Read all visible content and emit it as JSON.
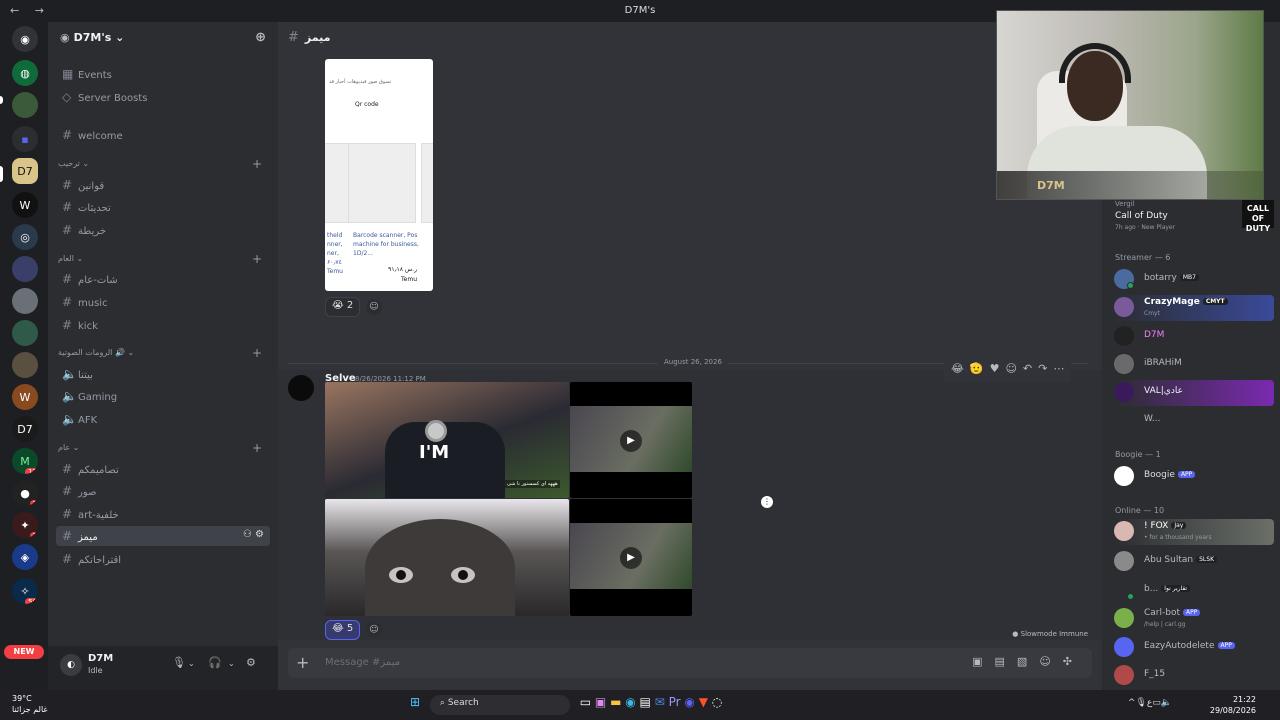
{
  "window": {
    "title": "D7M's",
    "nav": "← →"
  },
  "colors": {
    "blurple": "#5865f2",
    "online": "#23a55a",
    "danger": "#f23f43",
    "bg": "#313338"
  },
  "servers": {
    "badges": [
      "11",
      "3",
      "1",
      "56"
    ],
    "new_label": "NEW"
  },
  "server": {
    "name": "D7M's",
    "events": "Events",
    "boosts": "Server Boosts",
    "welcome": "welcome",
    "cat1": "ترحيب",
    "cat1_items": [
      "قوانين",
      "تحديثات",
      "خريطة"
    ],
    "cat2": "العام",
    "cat2_items": [
      "شات-عام",
      "music",
      "kick"
    ],
    "cat3": "الرومات الصوتية",
    "voice_items": [
      "بيتنا",
      "Gaming",
      "AFK"
    ],
    "cat4": "عام",
    "cat4_items": [
      "تصاميمكم",
      "صور",
      "art-خلفية",
      "ميمز",
      "اقتراحاتكم"
    ]
  },
  "user": {
    "name": "D7M",
    "status": "Idle"
  },
  "channel": {
    "name": "ميمز",
    "placeholder": "Message #ميمز"
  },
  "message1": {
    "product": {
      "tabs": "تسوق   صور   فيديوهات   أخبار   قد",
      "qr": "Qr code",
      "caption_left": "theld  nner, ner, ۶۰٫۷٤  Temu",
      "caption": "Barcode scanner, Pos machine for business, 1D/2...",
      "price": "۹۱٫۱۸ ر.س",
      "shop": "Temu"
    },
    "reaction_count": "2"
  },
  "date_divider": "August 26, 2026",
  "message2": {
    "author": "Selve",
    "time": "8/26/2026 11:12 PM",
    "caption": "هههه ای کسستور نا شی",
    "reaction_count": "5"
  },
  "slowmode": "Slowmode Immune",
  "activity": {
    "top": "Vergil",
    "game": "Call of Duty",
    "time": "7h ago",
    "status": "New Player",
    "badge": "CALL OF DUTY"
  },
  "webcam": {
    "overlay": "D7M"
  },
  "members": {
    "streamer_header": "Streamer — 6",
    "streamers": [
      {
        "name": "botarry",
        "tag": "MB7",
        "sub": ""
      },
      {
        "name": "CrazyMage",
        "tag": "CMYT",
        "sub": "Cmyt"
      },
      {
        "name": "D7M",
        "tag": "",
        "sub": ""
      },
      {
        "name": "iBRAHiM",
        "tag": "",
        "sub": ""
      },
      {
        "name": "VAL|عادي",
        "tag": "",
        "sub": ""
      },
      {
        "name": "W...",
        "tag": "",
        "sub": ""
      }
    ],
    "boogie_header": "Boogie — 1",
    "boogie": {
      "name": "Boogie",
      "tag": "APP"
    },
    "online_header": "Online — 10",
    "online": [
      {
        "name": "! FOX",
        "tag": "Jay",
        "sub": "• for a thousand years"
      },
      {
        "name": "Abu Sultan",
        "tag": "SLSK",
        "sub": ""
      },
      {
        "name": "b...",
        "tag": "تقارير نوا",
        "sub": ""
      },
      {
        "name": "Carl-bot",
        "tag": "APP",
        "sub": "/help | carl.gg"
      },
      {
        "name": "EazyAutodelete",
        "tag": "APP",
        "sub": ""
      },
      {
        "name": "F_15",
        "tag": "",
        "sub": ""
      }
    ]
  },
  "taskbar": {
    "temp": "39°C",
    "weather": "غالم جزائنا",
    "search": "Search",
    "time": "21:22",
    "date": "29/08/2026",
    "lang": "ع"
  }
}
